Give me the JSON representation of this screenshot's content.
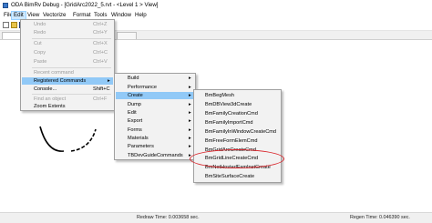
{
  "titlebar": {
    "title": "ODA BimRv Debug - [GridArc2022_5.rvt - <Level 1 > View]"
  },
  "menubar": {
    "items": [
      "File",
      "Edit",
      "View",
      "Vectorize",
      "Format",
      "Tools",
      "Window",
      "Help"
    ],
    "active": "Edit"
  },
  "edit_menu": {
    "items": [
      {
        "label": "Undo",
        "shortcut": "Ctrl+Z",
        "disabled": true
      },
      {
        "label": "Redo",
        "shortcut": "Ctrl+Y",
        "disabled": true
      },
      {
        "label": "Cut",
        "shortcut": "Ctrl+X",
        "disabled": true
      },
      {
        "label": "Copy",
        "shortcut": "Ctrl+C",
        "disabled": true
      },
      {
        "label": "Paste",
        "shortcut": "Ctrl+V",
        "disabled": true
      },
      {
        "label": "Recent command",
        "shortcut": "",
        "disabled": true
      },
      {
        "label": "Registered Commands",
        "shortcut": "",
        "disabled": false,
        "submenu": true,
        "highlighted": true
      },
      {
        "label": "Console...",
        "shortcut": "Shift+C",
        "disabled": false
      },
      {
        "label": "Find an object",
        "shortcut": "Ctrl+F",
        "disabled": true
      },
      {
        "label": "Zoom Extents",
        "shortcut": "",
        "disabled": false
      }
    ]
  },
  "registered_menu": {
    "items": [
      "Build",
      "Performance",
      "Create",
      "Dump",
      "Edit",
      "Export",
      "Forms",
      "Materials",
      "Parameters",
      "TBDevGuideCommands"
    ],
    "highlighted": "Create"
  },
  "create_menu": {
    "items": [
      "BmBegMesh",
      "BmDBView3dCreate",
      "BmFamilyCreationCmd",
      "BmFamilyImportCmd",
      "BmFamilyInWindowCreateCmd",
      "BmFreeFormElemCmd",
      "BmGridArcCreateCmd",
      "BmGridLineCreateCmd",
      "BmNotHostedFamInstCreate",
      "BmSiteSurfaceCreate"
    ],
    "circled": [
      "BmGridArcCreateCmd",
      "BmGridLineCreateCmd"
    ]
  },
  "statusbar": {
    "redraw": "Redraw Time: 0.003658 sec.",
    "regen": "Regen Time: 0.046390 sec."
  },
  "colors": {
    "highlight": "#91c9f7",
    "oval": "#d9252b",
    "menu_bg": "#f2f2f2"
  }
}
